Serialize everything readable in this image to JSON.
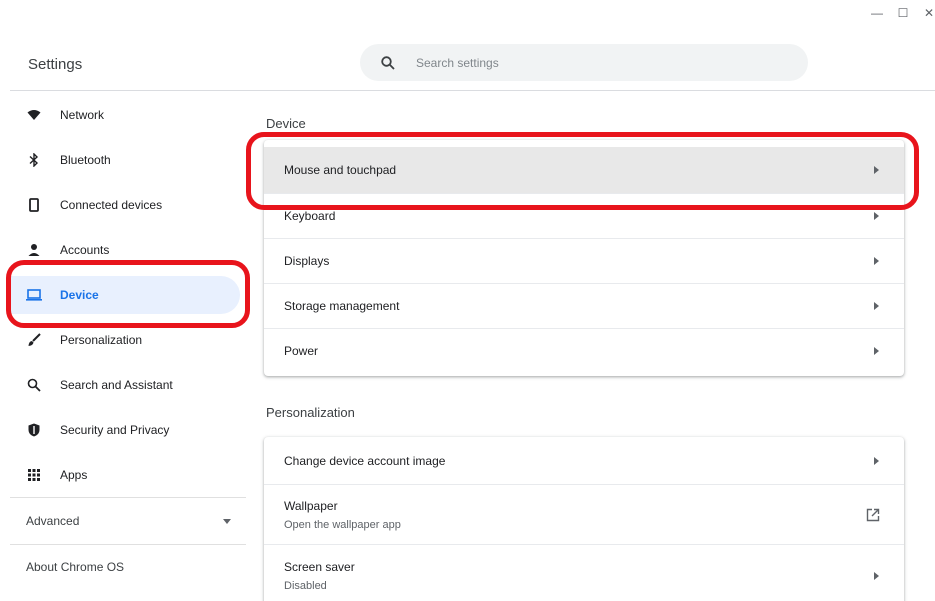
{
  "window": {
    "minimize_glyph": "—",
    "maximize_glyph": "☐",
    "close_glyph": "✕"
  },
  "app": {
    "title": "Settings"
  },
  "search": {
    "placeholder": "Search settings",
    "icon": "search-icon"
  },
  "sidebar": {
    "items": [
      {
        "label": "Network",
        "icon": "wifi-icon"
      },
      {
        "label": "Bluetooth",
        "icon": "bluetooth-icon"
      },
      {
        "label": "Connected devices",
        "icon": "phone-icon"
      },
      {
        "label": "Accounts",
        "icon": "person-icon"
      },
      {
        "label": "Device",
        "icon": "laptop-icon",
        "active": true
      },
      {
        "label": "Personalization",
        "icon": "brush-icon"
      },
      {
        "label": "Search and Assistant",
        "icon": "search-icon"
      },
      {
        "label": "Security and Privacy",
        "icon": "shield-icon"
      },
      {
        "label": "Apps",
        "icon": "apps-grid-icon"
      }
    ],
    "advanced_label": "Advanced",
    "about_label": "About Chrome OS"
  },
  "main": {
    "device_heading": "Device",
    "device_rows": [
      {
        "label": "Mouse and touchpad",
        "highlighted": true
      },
      {
        "label": "Keyboard"
      },
      {
        "label": "Displays"
      },
      {
        "label": "Storage management"
      },
      {
        "label": "Power"
      }
    ],
    "personalization_heading": "Personalization",
    "personalization_rows": [
      {
        "label": "Change device account image",
        "sub": ""
      },
      {
        "label": "Wallpaper",
        "sub": "Open the wallpaper app",
        "action": "external-link-icon"
      },
      {
        "label": "Screen saver",
        "sub": "Disabled"
      }
    ]
  },
  "colors": {
    "accent": "#1a73e8",
    "active_bg": "#e8f0fe",
    "annotation_red": "#e8141c",
    "highlight_row_bg": "#e8e8e8"
  }
}
